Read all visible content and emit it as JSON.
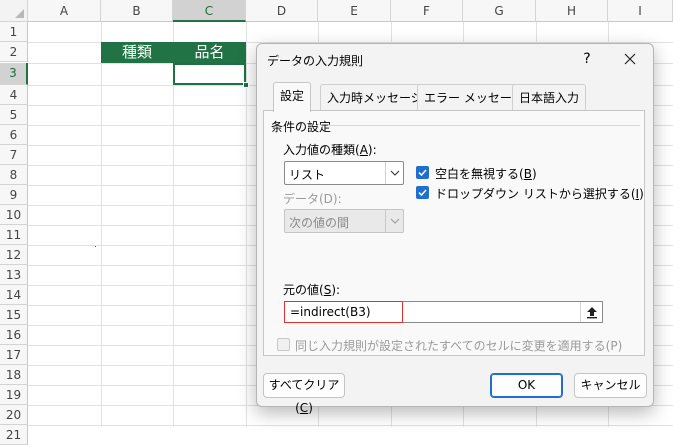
{
  "spreadsheet": {
    "columns": [
      "A",
      "B",
      "C",
      "D",
      "E",
      "F",
      "G",
      "H",
      "I"
    ],
    "rows": [
      "1",
      "2",
      "3",
      "4",
      "5",
      "6",
      "7",
      "8",
      "9",
      "10",
      "11",
      "12",
      "13",
      "14",
      "15",
      "16",
      "17",
      "18",
      "19",
      "20",
      "21"
    ],
    "selected_column": "C",
    "selected_row": "3",
    "cells": {
      "B2": "種類",
      "C2": "品名"
    },
    "header_fill_color": "#217346",
    "active_border_color": "#1e7145"
  },
  "dialog": {
    "title": "データの入力規則",
    "help_label": "?",
    "tabs": [
      {
        "label": "設定",
        "active": true
      },
      {
        "label": "入力時メッセージ",
        "active": false
      },
      {
        "label": "エラー メッセージ",
        "active": false
      },
      {
        "label": "日本語入力",
        "active": false
      }
    ],
    "group_label": "条件の設定",
    "allow": {
      "label": "入力値の種類",
      "mnemonic": "A",
      "value": "リスト"
    },
    "ignore_blank": {
      "label": "空白を無視する",
      "mnemonic": "B",
      "checked": true
    },
    "in_cell_dropdown": {
      "label": "ドロップダウン リストから選択する",
      "mnemonic": "I",
      "checked": true
    },
    "data": {
      "label": "データ(D):",
      "value": "次の値の間",
      "disabled": true
    },
    "source": {
      "label": "元の値",
      "mnemonic": "S",
      "value": "=indirect(B3)"
    },
    "apply_all": {
      "label": "同じ入力規則が設定されたすべてのセルに変更を適用する(P)",
      "checked": false,
      "disabled": true
    },
    "clear_all": {
      "label": "すべてクリア",
      "mnemonic": "C"
    },
    "ok_label": "OK",
    "cancel_label": "キャンセル",
    "accent_color": "#1f6fd0",
    "highlight_color": "#e03030"
  }
}
